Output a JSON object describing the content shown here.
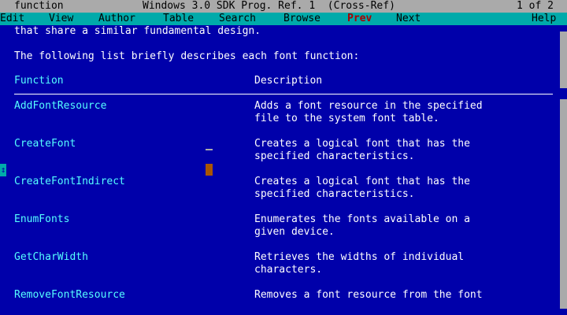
{
  "titlebar": {
    "left": "function",
    "center": "Windows 3.0 SDK Prog. Ref. 1  (Cross-Ref)",
    "right": "1 of 2"
  },
  "menu": {
    "edit": "Edit",
    "view": "View",
    "author": "Author",
    "table": "Table",
    "search": "Search",
    "browse": "Browse",
    "prev": "Prev",
    "next": "Next",
    "help": "Help"
  },
  "content": {
    "intro_line": "that share a similar fundamental design.",
    "list_intro": "The following list briefly describes each font function:",
    "header_function": "Function",
    "header_description": "Description",
    "rows": [
      {
        "fn": "AddFontResource",
        "desc1": "Adds a font resource in the specified",
        "desc2": "file to the system font table."
      },
      {
        "fn": "CreateFont",
        "desc1": "Creates a logical font that has the",
        "desc2": "specified characteristics."
      },
      {
        "fn": "CreateFontIndirect",
        "desc1": "Creates a logical font that has the",
        "desc2": "specified characteristics."
      },
      {
        "fn": "EnumFonts",
        "desc1": "Enumerates the fonts available on a",
        "desc2": "given device."
      },
      {
        "fn": "GetCharWidth",
        "desc1": "Retrieves the widths of individual",
        "desc2": "characters."
      },
      {
        "fn": "RemoveFontResource",
        "desc1": "Removes a font resource from the font",
        "desc2": ""
      }
    ]
  },
  "side_marker_glyph": "↕",
  "colors": {
    "background": "#0000aa",
    "titlebar": "#aaaaaa",
    "menubar": "#00aaaa",
    "link": "#55ffff",
    "text": "#ffffff",
    "prev_highlight": "#aa0000",
    "cursor": "#aa5500"
  }
}
